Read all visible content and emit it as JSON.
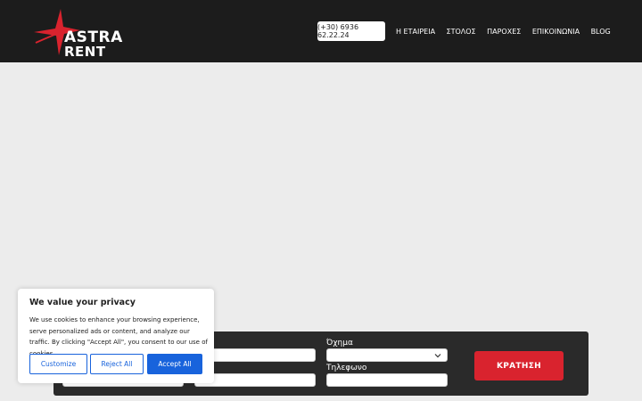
{
  "header": {
    "logo": {
      "line1": "ASTRA",
      "line2": "RENT",
      "star_color": "#d9232e"
    },
    "phone": "(+30) 6936 62.22.24",
    "nav": [
      "Η ΕΤΑΙΡΕΙΑ",
      "ΣΤΟΛΟΣ",
      "ΠΑΡΟΧΕΣ",
      "ΕΠΙΚΟΙΝΩΝΙΑ",
      "BLOG"
    ]
  },
  "booking_form": {
    "vehicle_label": "Όχημα",
    "phone_label": "Τηλεφωνο",
    "submit_label": "ΚΡΑΤΗΣΗ",
    "accent": "#d9232e"
  },
  "cookie_banner": {
    "title": "We value your privacy",
    "body": "We use cookies to enhance your browsing experience, serve personalized ads or content, and analyze our traffic. By clicking \"Accept All\", you consent to our use of cookies.",
    "customize": "Customize",
    "reject": "Reject All",
    "accept": "Accept All",
    "accent": "#1863dc"
  }
}
